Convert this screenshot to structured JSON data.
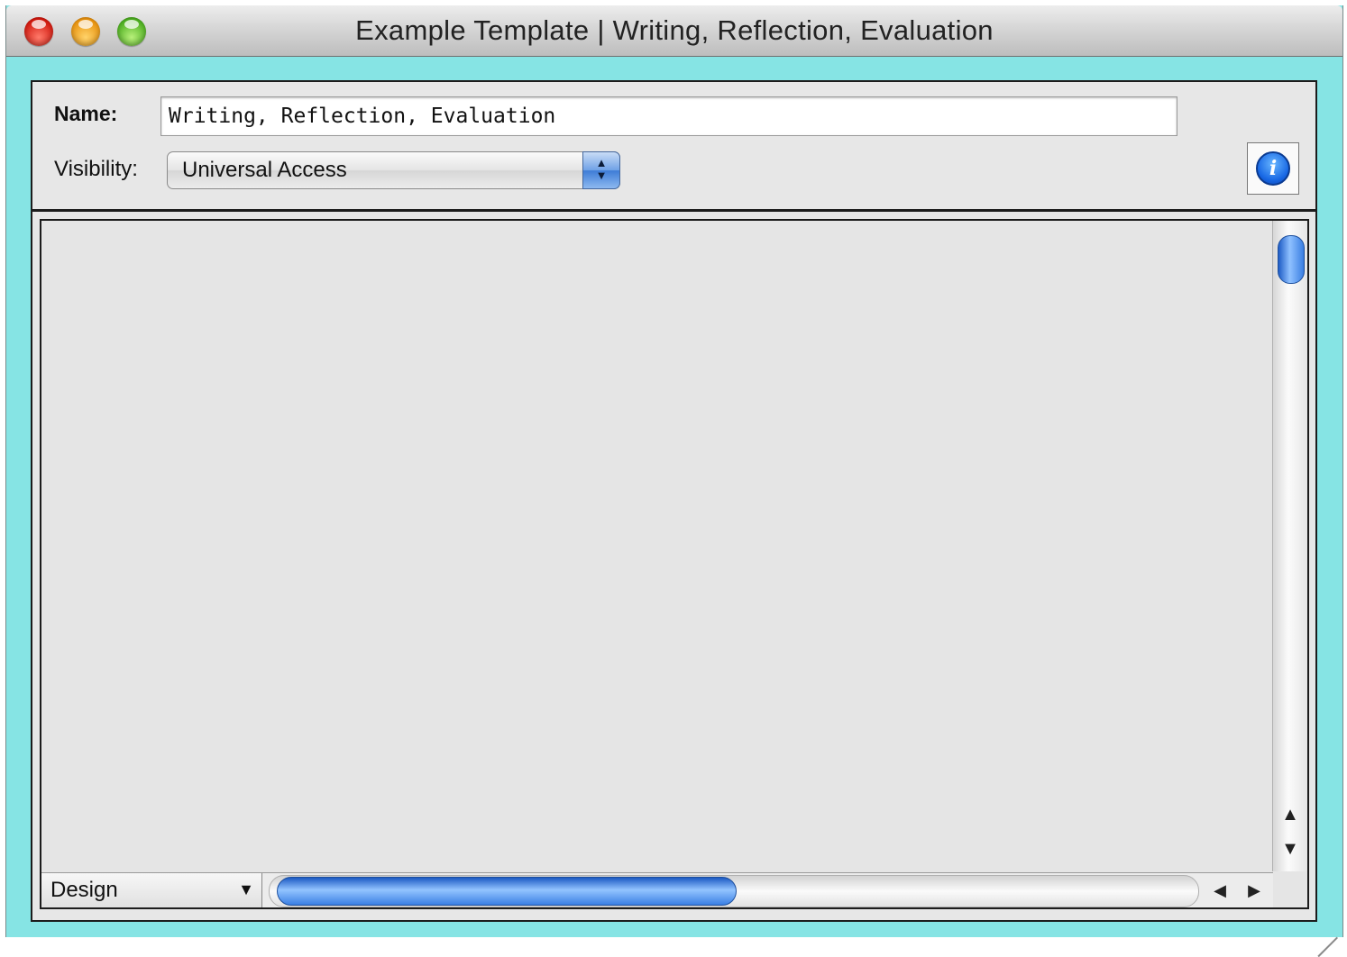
{
  "window": {
    "title": "Example Template | Writing, Reflection, Evaluation",
    "background_color": "#86e4e4"
  },
  "form": {
    "name_label": "Name:",
    "name_value": "Writing, Reflection, Evaluation",
    "visibility_label": "Visibility:",
    "visibility_value": "Universal Access",
    "info_icon_glyph": "i"
  },
  "bottom_bar": {
    "layout_mode": "Design",
    "caret": "▼"
  },
  "scroll_arrows": {
    "up": "▲",
    "down": "▼",
    "left": "◀",
    "right": "▶"
  },
  "icons": {
    "close": "close-light-icon",
    "minimize": "minimize-light-icon",
    "zoom": "zoom-light-icon",
    "info": "info-icon",
    "select_arrows": "up-down-arrows-icon",
    "grow": "resize-grip-icon"
  }
}
